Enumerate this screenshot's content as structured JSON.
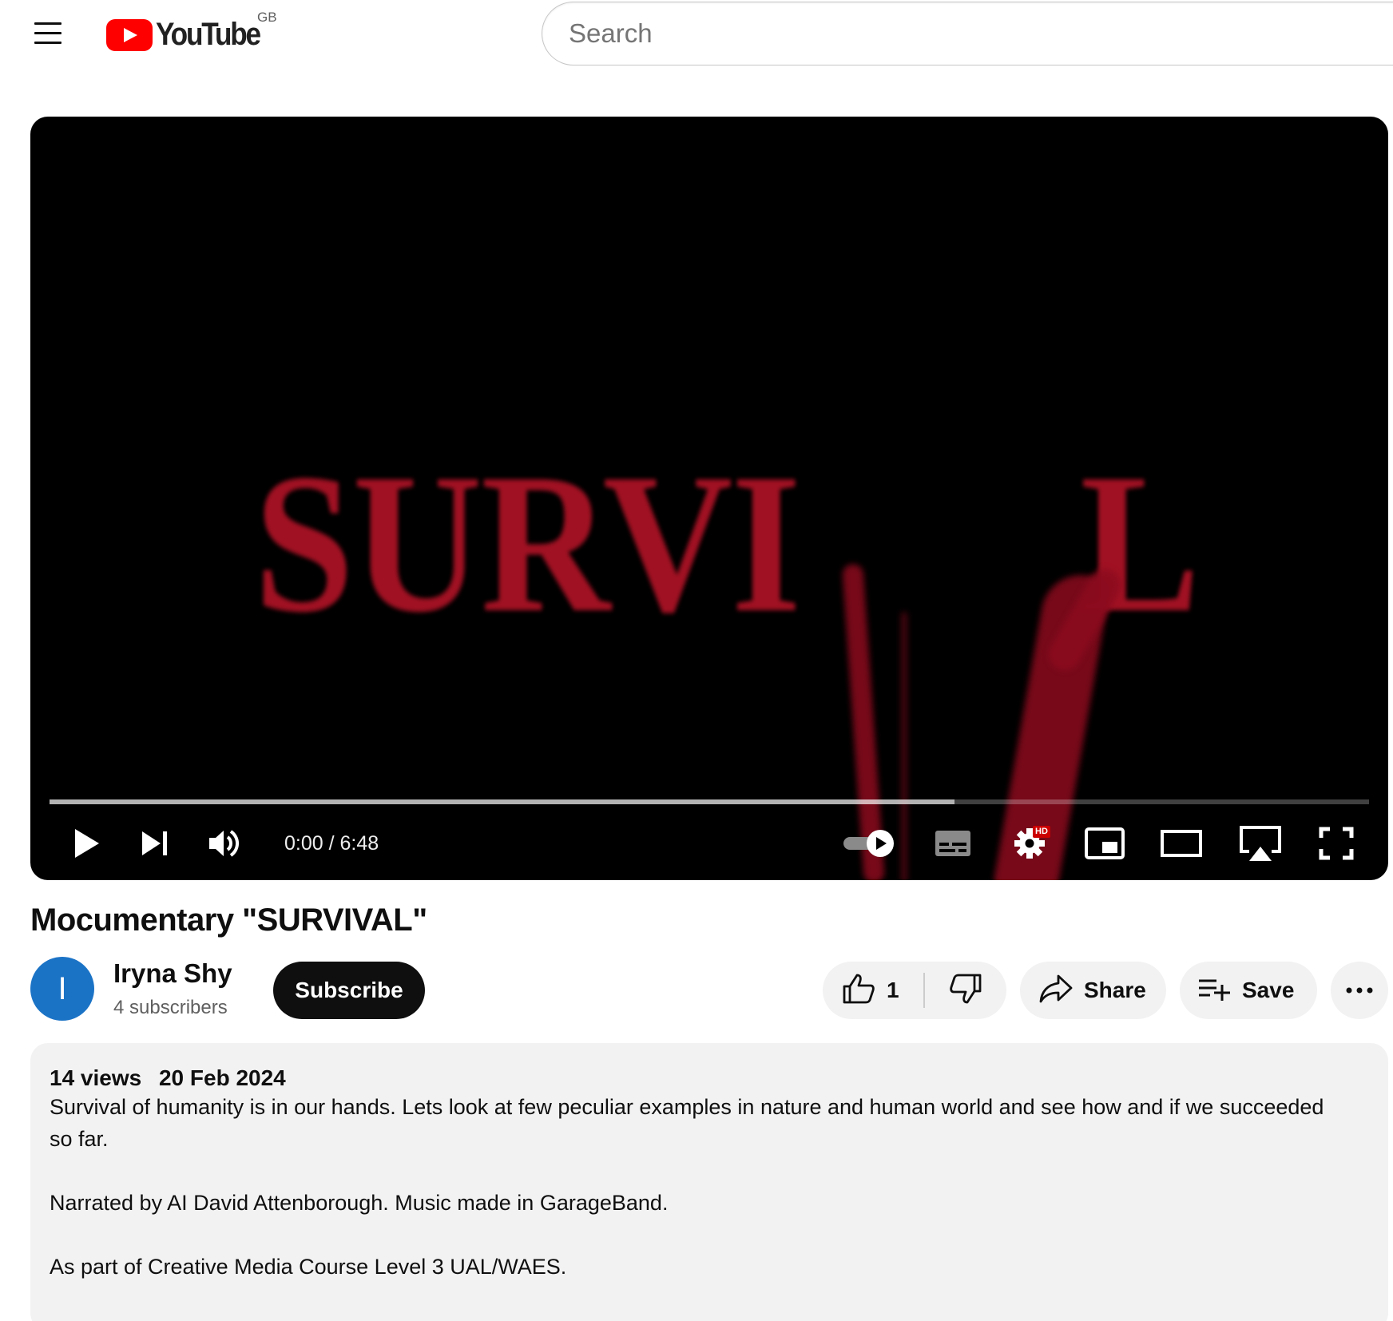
{
  "masthead": {
    "logo_text": "YouTube",
    "region": "GB",
    "search_placeholder": "Search",
    "menu_icon": "hamburger-menu-icon"
  },
  "player": {
    "frame_text_left": "SURVI",
    "frame_text_right": "L",
    "time_current": "0:00",
    "time_separator": "/",
    "time_total": "6:48",
    "loaded_fraction": 0.686,
    "hd_badge": "HD",
    "icons": [
      "play-icon",
      "next-icon",
      "volume-icon",
      "autoplay-toggle-icon",
      "subtitles-icon",
      "settings-icon",
      "miniplayer-icon",
      "theater-mode-icon",
      "airplay-icon",
      "fullscreen-icon"
    ]
  },
  "video": {
    "title": "Mocumentary \"SURVIVAL\""
  },
  "owner": {
    "avatar_letter": "I",
    "channel_name": "Iryna Shy",
    "subscribers": "4 subscribers",
    "subscribe_label": "Subscribe"
  },
  "actions": {
    "like_count": "1",
    "share_label": "Share",
    "save_label": "Save",
    "more_icon": "more-horizontal-icon"
  },
  "description": {
    "views": "14 views",
    "date": "20 Feb 2024",
    "paragraph_1_line_1": "Survival of humanity is in our hands. Lets look at few peculiar examples in nature and human world and see how and if we succeeded",
    "paragraph_1_line_2": "so far.",
    "paragraph_2": "Narrated by AI David Attenborough. Music made in GarageBand.",
    "paragraph_3": "As part of Creative Media Course Level 3 UAL/WAES."
  },
  "colors": {
    "brand_red": "#ff0000",
    "title_red": "#b21327",
    "avatar_blue": "#1b73c6",
    "pill_bg": "#f2f2f2"
  }
}
